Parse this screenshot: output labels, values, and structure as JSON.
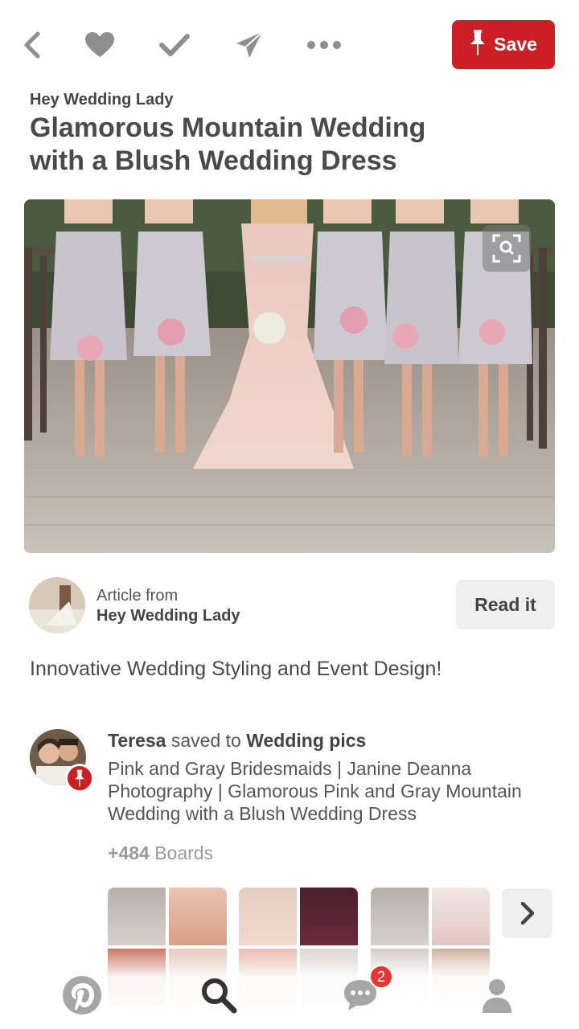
{
  "toolbar": {
    "icons": [
      "back-chevron-icon",
      "heart-icon",
      "checkmark-icon",
      "send-icon",
      "more-dots-icon"
    ],
    "save_label": "Save",
    "save_color": "#cb1e25"
  },
  "pin": {
    "source": "Hey Wedding Lady",
    "title": "Glamorous Mountain Wedding with a Blush Wedding Dress"
  },
  "article": {
    "label": "Article from",
    "source": "Hey Wedding Lady",
    "read_label": "Read it"
  },
  "description": "Innovative Wedding Styling and Event Design!",
  "saver": {
    "name": "Teresa",
    "action": " saved to ",
    "board": "Wedding pics",
    "description": "Pink and Gray Bridesmaids | Janine Deanna Photography | Glamorous Pink and Gray Mountain Wedding with a Blush Wedding Dress",
    "boards_count": "+484",
    "boards_label": " Boards"
  },
  "bottom_nav": {
    "icons": [
      "pinterest-logo-icon",
      "search-icon",
      "chat-icon",
      "profile-icon"
    ],
    "notification_count": "2"
  },
  "colors": {
    "brand_red": "#cb1e25",
    "badge_red": "#e63535",
    "icon_gray": "#8e8e8e"
  }
}
